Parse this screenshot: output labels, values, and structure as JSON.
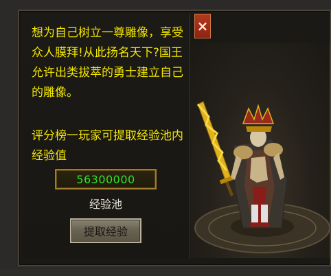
{
  "dialog": {
    "intro_text": "想为自己树立一尊雕像，享受众人膜拜!从此扬名天下?国王允许出类拔萃的勇士建立自己的雕像。",
    "rank_text": "评分榜一玩家可提取经验池内经验值",
    "exp_pool_value": "56300000",
    "exp_pool_label": "经验池",
    "claim_button_label": "提取经验",
    "close_button_label": "×"
  },
  "colors": {
    "text_yellow": "#f2e600",
    "value_green": "#2fe22f",
    "close_red": "#a32e17"
  },
  "icons": {
    "close": "close-icon",
    "statue": "warrior-statue"
  }
}
